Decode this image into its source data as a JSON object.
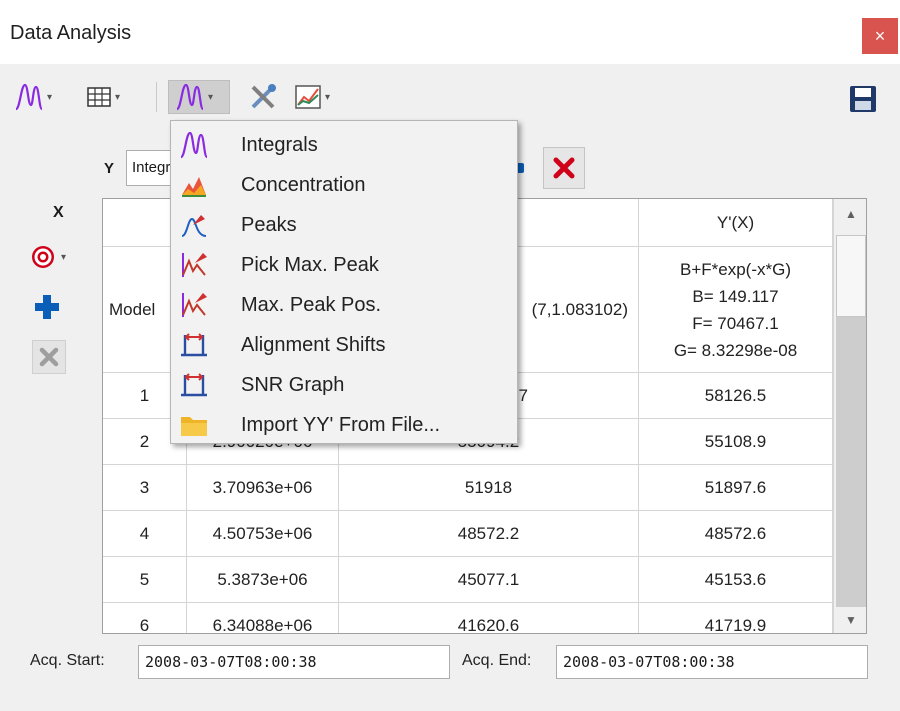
{
  "window": {
    "title": "Data Analysis",
    "close_label": "×"
  },
  "toolbar": {
    "icons": [
      "integral-icon",
      "table-icon",
      "peak-shape-icon",
      "tools-icon",
      "chart-icon",
      "save-icon"
    ],
    "dropdown_arrow": "▾"
  },
  "y_axis": {
    "label": "Y",
    "selected": "Integrals"
  },
  "x_axis": {
    "label": "X"
  },
  "table": {
    "corner_text": "",
    "columns": [
      "",
      "",
      "Y'(X)"
    ],
    "model_row": {
      "header": "Model",
      "col2": "(7,1.083102)",
      "col3": [
        "B+F*exp(-x*G)",
        "B= 149.117",
        "F= 70467.1",
        "G= 8.32298e-08"
      ]
    },
    "rows": [
      {
        "index": "1",
        "x": "",
        "y": "7",
        "yfit": "58126.5"
      },
      {
        "index": "2",
        "x": "2.90020e+06",
        "y": "55094.2",
        "yfit": "55108.9"
      },
      {
        "index": "3",
        "x": "3.70963e+06",
        "y": "51918",
        "yfit": "51897.6"
      },
      {
        "index": "4",
        "x": "4.50753e+06",
        "y": "48572.2",
        "yfit": "48572.6"
      },
      {
        "index": "5",
        "x": "5.3873e+06",
        "y": "45077.1",
        "yfit": "45153.6"
      },
      {
        "index": "6",
        "x": "6.34088e+06",
        "y": "41620.6",
        "yfit": "41719.9"
      }
    ]
  },
  "acquisition": {
    "start_label": "Acq. Start:",
    "start_value": "2008-03-07T08:00:38",
    "end_label": "Acq. End:",
    "end_value": "2008-03-07T08:00:38"
  },
  "menu": {
    "items": [
      {
        "label": "Integrals",
        "icon": "integral-icon"
      },
      {
        "label": "Concentration",
        "icon": "concentration-icon"
      },
      {
        "label": "Peaks",
        "icon": "peaks-icon"
      },
      {
        "label": "Pick Max. Peak",
        "icon": "pick-max-peak-icon"
      },
      {
        "label": "Max. Peak Pos.",
        "icon": "max-peak-pos-icon"
      },
      {
        "label": "Alignment Shifts",
        "icon": "alignment-shifts-icon"
      },
      {
        "label": "SNR Graph",
        "icon": "snr-graph-icon"
      },
      {
        "label": "Import YY' From File...",
        "icon": "folder-icon"
      }
    ]
  },
  "colors": {
    "accent_blue": "#0a5eb8",
    "delete_red": "#d0021b",
    "close_red": "#d9534f",
    "integral_purple": "#8a2be2"
  }
}
